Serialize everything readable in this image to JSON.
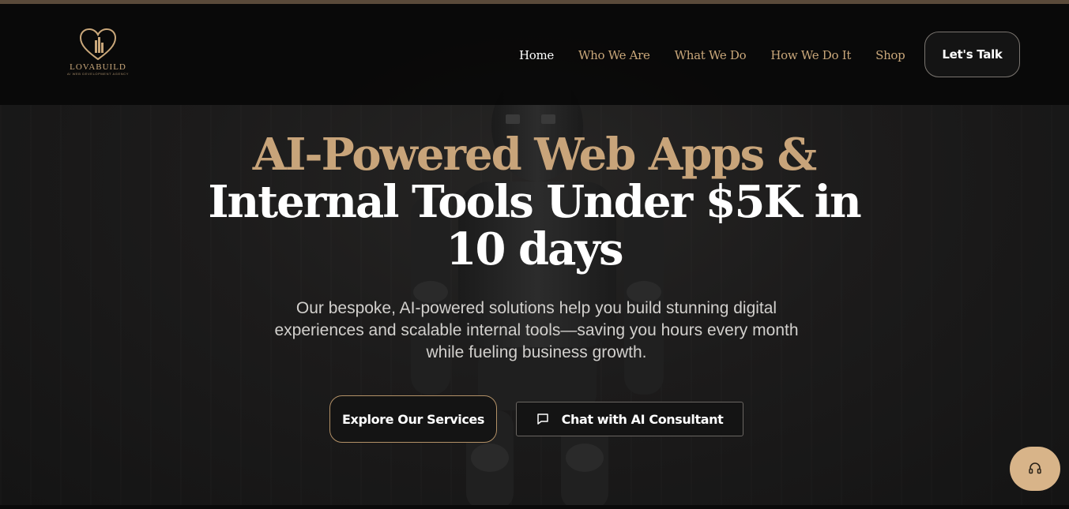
{
  "colors": {
    "accent_gold": "#c8a47a",
    "background": "#1a1919",
    "header_bg": "#080808",
    "fab_bg": "#d8b489"
  },
  "logo": {
    "name": "LOVABUILD",
    "tagline": "AI WEB DEVELOPMENT AGENCY",
    "icon": "heart-building-icon"
  },
  "nav": {
    "items": [
      {
        "label": "Home",
        "active": true
      },
      {
        "label": "Who We Are",
        "active": false
      },
      {
        "label": "What We Do",
        "active": false
      },
      {
        "label": "How We Do It",
        "active": false
      },
      {
        "label": "Shop",
        "active": false
      }
    ],
    "cta_label": "Let's Talk"
  },
  "hero": {
    "title_line1": "AI-Powered Web Apps &",
    "title_line2": "Internal Tools Under $5K in",
    "title_line3": "10 days",
    "subtitle": "Our bespoke, AI-powered solutions help you build stunning digital experiences and scalable internal tools—saving you hours every month while fueling business growth.",
    "primary_button": "Explore Our Services",
    "secondary_button": "Chat with AI Consultant",
    "secondary_icon": "chat-bubble-icon"
  },
  "support_widget": {
    "icon": "headset-icon"
  }
}
